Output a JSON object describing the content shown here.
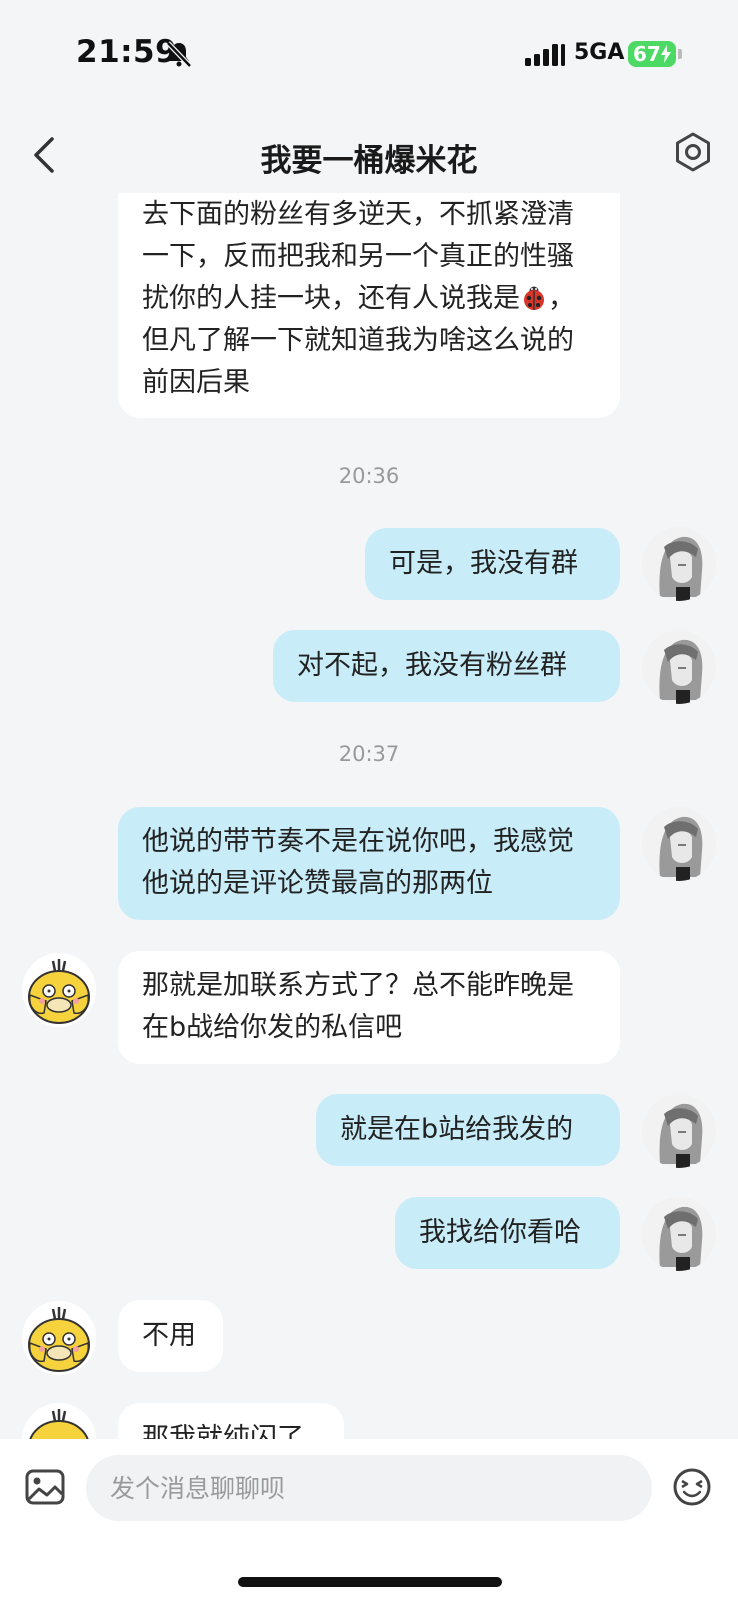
{
  "status_bar": {
    "time": "21:59",
    "network": "5GA",
    "battery": "67",
    "icons": [
      "bell-muted-icon",
      "signal-icon",
      "battery-charging-icon"
    ]
  },
  "header": {
    "title": "我要一桶爆米花",
    "icons": [
      "back-icon",
      "settings-icon"
    ]
  },
  "messages": [
    {
      "side": "in",
      "text": "去下面的粉丝有多逆天，不抓紧澄清一下，反而把我和另一个真正的性骚扰你的人挂一块，还有人说我是",
      "text_after_emoji": "，但凡了解一下就知道我为啥这么说的前因后果",
      "emoji": "ladybug-emoji"
    },
    {
      "type": "timestamp",
      "text": "20:36"
    },
    {
      "side": "out",
      "text": "可是，我没有群"
    },
    {
      "side": "out",
      "text": "对不起，我没有粉丝群"
    },
    {
      "type": "timestamp",
      "text": "20:37"
    },
    {
      "side": "out",
      "text": "他说的带节奏不是在说你吧，我感觉他说的是评论赞最高的那两位"
    },
    {
      "side": "in",
      "text": "那就是加联系方式了？总不能昨晚是在b战给你发的私信吧"
    },
    {
      "side": "out",
      "text": "就是在b站给我发的"
    },
    {
      "side": "out",
      "text": "我找给你看哈"
    },
    {
      "side": "in",
      "text": "不用"
    },
    {
      "side": "in",
      "text": "那我就纯闪了"
    }
  ],
  "input_bar": {
    "placeholder": "发个消息聊聊呗",
    "icons": [
      "image-icon",
      "emoji-icon"
    ]
  },
  "colors": {
    "background": "#f4f5f7",
    "incoming_bubble": "#ffffff",
    "outgoing_bubble": "#c8ecf8",
    "battery": "#4cd964"
  }
}
